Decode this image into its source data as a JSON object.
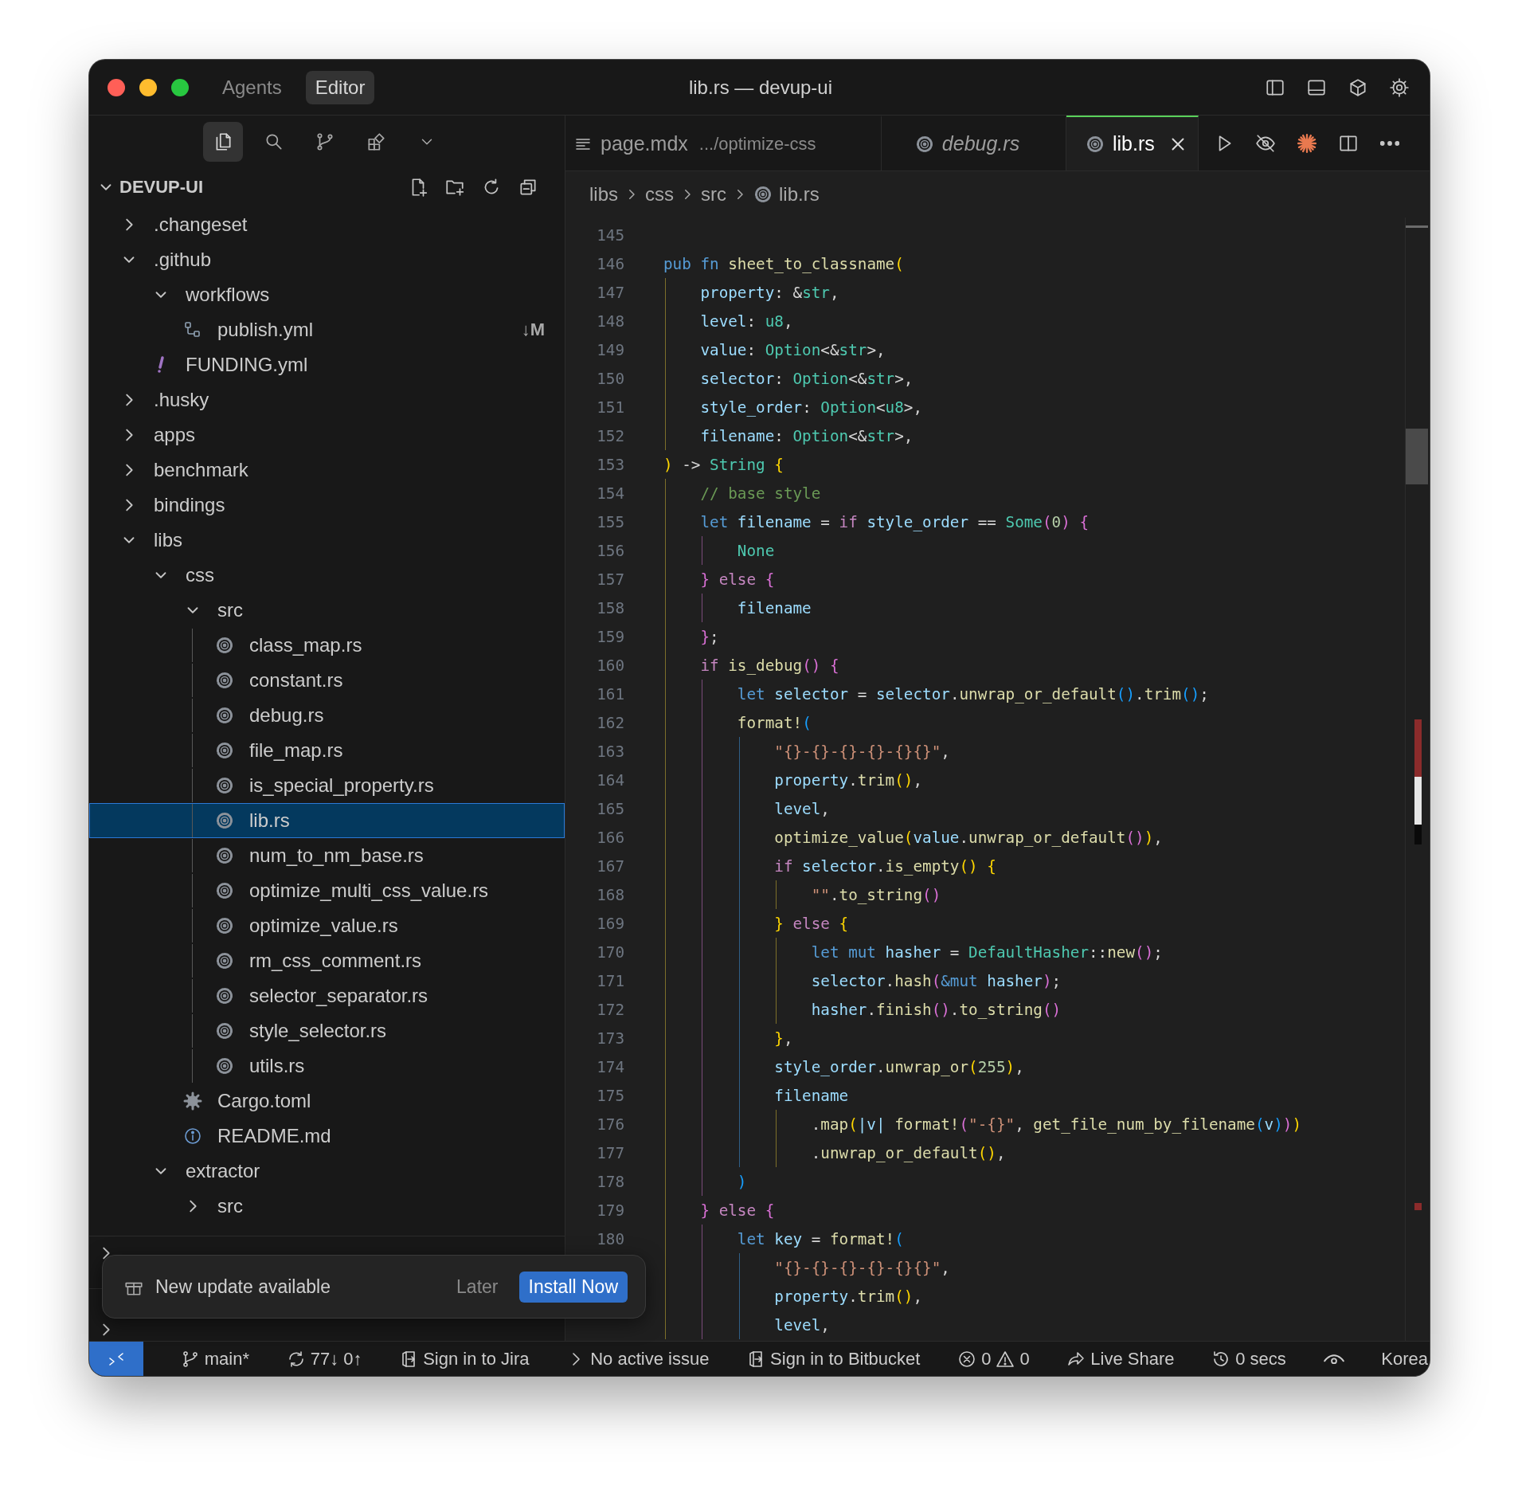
{
  "window": {
    "title": "lib.rs — devup-ui"
  },
  "mode_tabs": [
    {
      "label": "Agents",
      "selected": false
    },
    {
      "label": "Editor",
      "selected": true
    }
  ],
  "activity_bar": [
    {
      "selected": true
    },
    {
      "selected": false
    },
    {
      "selected": false
    },
    {
      "selected": false
    }
  ],
  "explorer": {
    "title": "DEVUP-UI",
    "expanded": true,
    "tree": [
      {
        "label": ".changeset",
        "kind": "folder",
        "expanded": false,
        "selected": false
      },
      {
        "label": ".github",
        "kind": "folder",
        "expanded": true,
        "selected": false,
        "children": [
          {
            "label": "workflows",
            "kind": "folder",
            "expanded": true,
            "selected": false,
            "children": [
              {
                "label": "publish.yml",
                "kind": "workflow",
                "selected": false,
                "badge": "↓M"
              }
            ]
          },
          {
            "label": "FUNDING.yml",
            "kind": "yaml",
            "selected": false
          }
        ]
      },
      {
        "label": ".husky",
        "kind": "folder",
        "expanded": false,
        "selected": false
      },
      {
        "label": "apps",
        "kind": "folder",
        "expanded": false,
        "selected": false
      },
      {
        "label": "benchmark",
        "kind": "folder",
        "expanded": false,
        "selected": false
      },
      {
        "label": "bindings",
        "kind": "folder",
        "expanded": false,
        "selected": false
      },
      {
        "label": "libs",
        "kind": "folder",
        "expanded": true,
        "selected": false,
        "children": [
          {
            "label": "css",
            "kind": "folder",
            "expanded": true,
            "selected": false,
            "children": [
              {
                "label": "src",
                "kind": "folder",
                "expanded": true,
                "selected": false,
                "children": [
                  {
                    "label": "class_map.rs",
                    "kind": "rust",
                    "selected": false
                  },
                  {
                    "label": "constant.rs",
                    "kind": "rust",
                    "selected": false
                  },
                  {
                    "label": "debug.rs",
                    "kind": "rust",
                    "selected": false
                  },
                  {
                    "label": "file_map.rs",
                    "kind": "rust",
                    "selected": false
                  },
                  {
                    "label": "is_special_property.rs",
                    "kind": "rust",
                    "selected": false
                  },
                  {
                    "label": "lib.rs",
                    "kind": "rust",
                    "selected": true
                  },
                  {
                    "label": "num_to_nm_base.rs",
                    "kind": "rust",
                    "selected": false
                  },
                  {
                    "label": "optimize_multi_css_value.rs",
                    "kind": "rust",
                    "selected": false
                  },
                  {
                    "label": "optimize_value.rs",
                    "kind": "rust",
                    "selected": false
                  },
                  {
                    "label": "rm_css_comment.rs",
                    "kind": "rust",
                    "selected": false
                  },
                  {
                    "label": "selector_separator.rs",
                    "kind": "rust",
                    "selected": false
                  },
                  {
                    "label": "style_selector.rs",
                    "kind": "rust",
                    "selected": false
                  },
                  {
                    "label": "utils.rs",
                    "kind": "rust",
                    "selected": false
                  }
                ]
              },
              {
                "label": "Cargo.toml",
                "kind": "config",
                "selected": false
              },
              {
                "label": "README.md",
                "kind": "info",
                "selected": false
              }
            ]
          },
          {
            "label": "extractor",
            "kind": "folder",
            "expanded": true,
            "selected": false,
            "children": [
              {
                "label": "src",
                "kind": "folder",
                "expanded": false,
                "selected": false
              }
            ]
          }
        ]
      }
    ]
  },
  "sections": [
    {
      "expanded": false
    },
    {
      "expanded": false
    }
  ],
  "tabs": [
    {
      "label": "page.mdx",
      "description": ".../optimize-css",
      "kind": "markdown",
      "selected": false,
      "preview": false
    },
    {
      "label": "debug.rs",
      "kind": "rust",
      "selected": false,
      "preview": true
    },
    {
      "label": "lib.rs",
      "kind": "rust",
      "selected": true,
      "preview": false
    }
  ],
  "breadcrumb": [
    {
      "label": "libs",
      "kind": "folder"
    },
    {
      "label": "css",
      "kind": "folder"
    },
    {
      "label": "src",
      "kind": "folder"
    },
    {
      "label": "lib.rs",
      "kind": "rust"
    }
  ],
  "editor": {
    "lines": [
      {
        "number": "145"
      },
      {
        "number": "146",
        "tokens": [
          {
            "text": "pub",
            "kind": "keyword"
          },
          {
            "text": " fn",
            "kind": "keyword"
          },
          {
            "text": " sheet_to_classname",
            "kind": "function"
          },
          {
            "text": "(",
            "kind": "bracket1"
          }
        ]
      },
      {
        "number": "147",
        "tokens": [
          {
            "text": "    property",
            "kind": "variable"
          },
          {
            "text": ": &",
            "kind": "plain"
          },
          {
            "text": "str",
            "kind": "type"
          },
          {
            "text": ",",
            "kind": "plain"
          }
        ]
      },
      {
        "number": "148",
        "tokens": [
          {
            "text": "    level",
            "kind": "variable"
          },
          {
            "text": ": ",
            "kind": "plain"
          },
          {
            "text": "u8",
            "kind": "type"
          },
          {
            "text": ",",
            "kind": "plain"
          }
        ]
      },
      {
        "number": "149",
        "tokens": [
          {
            "text": "    value",
            "kind": "variable"
          },
          {
            "text": ": ",
            "kind": "plain"
          },
          {
            "text": "Option",
            "kind": "type"
          },
          {
            "text": "<&",
            "kind": "plain"
          },
          {
            "text": "str",
            "kind": "type"
          },
          {
            "text": ">,",
            "kind": "plain"
          }
        ]
      },
      {
        "number": "150",
        "tokens": [
          {
            "text": "    selector",
            "kind": "variable"
          },
          {
            "text": ": ",
            "kind": "plain"
          },
          {
            "text": "Option",
            "kind": "type"
          },
          {
            "text": "<&",
            "kind": "plain"
          },
          {
            "text": "str",
            "kind": "type"
          },
          {
            "text": ">,",
            "kind": "plain"
          }
        ]
      },
      {
        "number": "151",
        "tokens": [
          {
            "text": "    style_order",
            "kind": "variable"
          },
          {
            "text": ": ",
            "kind": "plain"
          },
          {
            "text": "Option",
            "kind": "type"
          },
          {
            "text": "<",
            "kind": "plain"
          },
          {
            "text": "u8",
            "kind": "type"
          },
          {
            "text": ">,",
            "kind": "plain"
          }
        ]
      },
      {
        "number": "152",
        "tokens": [
          {
            "text": "    filename",
            "kind": "variable"
          },
          {
            "text": ": ",
            "kind": "plain"
          },
          {
            "text": "Option",
            "kind": "type"
          },
          {
            "text": "<&",
            "kind": "plain"
          },
          {
            "text": "str",
            "kind": "type"
          },
          {
            "text": ">,",
            "kind": "plain"
          }
        ]
      },
      {
        "number": "153",
        "tokens": [
          {
            "text": ")",
            "kind": "bracket1"
          },
          {
            "text": " -> ",
            "kind": "plain"
          },
          {
            "text": "String",
            "kind": "type"
          },
          {
            "text": " {",
            "kind": "bracket1"
          }
        ]
      },
      {
        "number": "154",
        "tokens": [
          {
            "text": "    // base style",
            "kind": "comment"
          }
        ]
      },
      {
        "number": "155",
        "tokens": [
          {
            "text": "    let",
            "kind": "keyword"
          },
          {
            "text": " filename",
            "kind": "variable"
          },
          {
            "text": " = ",
            "kind": "plain"
          },
          {
            "text": "if",
            "kind": "control"
          },
          {
            "text": " style_order",
            "kind": "variable"
          },
          {
            "text": " == ",
            "kind": "plain"
          },
          {
            "text": "Some",
            "kind": "type"
          },
          {
            "text": "(",
            "kind": "bracket2"
          },
          {
            "text": "0",
            "kind": "number"
          },
          {
            "text": ")",
            "kind": "bracket2"
          },
          {
            "text": " {",
            "kind": "bracket2"
          }
        ]
      },
      {
        "number": "156",
        "tokens": [
          {
            "text": "        None",
            "kind": "type"
          }
        ]
      },
      {
        "number": "157",
        "tokens": [
          {
            "text": "    }",
            "kind": "bracket2"
          },
          {
            "text": " else",
            "kind": "control"
          },
          {
            "text": " {",
            "kind": "bracket2"
          }
        ]
      },
      {
        "number": "158",
        "tokens": [
          {
            "text": "        filename",
            "kind": "variable"
          }
        ]
      },
      {
        "number": "159",
        "tokens": [
          {
            "text": "    }",
            "kind": "bracket2"
          },
          {
            "text": ";",
            "kind": "plain"
          }
        ]
      },
      {
        "number": "160",
        "tokens": [
          {
            "text": "    if",
            "kind": "control"
          },
          {
            "text": " is_debug",
            "kind": "function"
          },
          {
            "text": "()",
            "kind": "bracket2"
          },
          {
            "text": " {",
            "kind": "bracket2"
          }
        ]
      },
      {
        "number": "161",
        "tokens": [
          {
            "text": "        let",
            "kind": "keyword"
          },
          {
            "text": " selector",
            "kind": "variable"
          },
          {
            "text": " = ",
            "kind": "plain"
          },
          {
            "text": "selector",
            "kind": "variable"
          },
          {
            "text": ".unwrap_or_default",
            "kind": "function"
          },
          {
            "text": "()",
            "kind": "bracket3"
          },
          {
            "text": ".trim",
            "kind": "function"
          },
          {
            "text": "()",
            "kind": "bracket3"
          },
          {
            "text": ";",
            "kind": "plain"
          }
        ]
      },
      {
        "number": "162",
        "tokens": [
          {
            "text": "        format!",
            "kind": "function"
          },
          {
            "text": "(",
            "kind": "bracket3"
          }
        ]
      },
      {
        "number": "163",
        "tokens": [
          {
            "text": "            \"{}-{}-{}-{}-{}{}\"",
            "kind": "string"
          },
          {
            "text": ",",
            "kind": "plain"
          }
        ]
      },
      {
        "number": "164",
        "tokens": [
          {
            "text": "            property",
            "kind": "variable"
          },
          {
            "text": ".trim",
            "kind": "function"
          },
          {
            "text": "()",
            "kind": "bracket1"
          },
          {
            "text": ",",
            "kind": "plain"
          }
        ]
      },
      {
        "number": "165",
        "tokens": [
          {
            "text": "            level",
            "kind": "variable"
          },
          {
            "text": ",",
            "kind": "plain"
          }
        ]
      },
      {
        "number": "166",
        "tokens": [
          {
            "text": "            optimize_value",
            "kind": "function"
          },
          {
            "text": "(",
            "kind": "bracket1"
          },
          {
            "text": "value",
            "kind": "variable"
          },
          {
            "text": ".unwrap_or_default",
            "kind": "function"
          },
          {
            "text": "()",
            "kind": "bracket2"
          },
          {
            "text": ")",
            "kind": "bracket1"
          },
          {
            "text": ",",
            "kind": "plain"
          }
        ]
      },
      {
        "number": "167",
        "tokens": [
          {
            "text": "            if",
            "kind": "control"
          },
          {
            "text": " selector",
            "kind": "variable"
          },
          {
            "text": ".is_empty",
            "kind": "function"
          },
          {
            "text": "()",
            "kind": "bracket1"
          },
          {
            "text": " {",
            "kind": "bracket1"
          }
        ]
      },
      {
        "number": "168",
        "tokens": [
          {
            "text": "                \"\"",
            "kind": "string"
          },
          {
            "text": ".to_string",
            "kind": "function"
          },
          {
            "text": "()",
            "kind": "bracket2"
          }
        ]
      },
      {
        "number": "169",
        "tokens": [
          {
            "text": "            }",
            "kind": "bracket1"
          },
          {
            "text": " else",
            "kind": "control"
          },
          {
            "text": " {",
            "kind": "bracket1"
          }
        ]
      },
      {
        "number": "170",
        "tokens": [
          {
            "text": "                let",
            "kind": "keyword"
          },
          {
            "text": " mut",
            "kind": "keyword"
          },
          {
            "text": " hasher",
            "kind": "variable"
          },
          {
            "text": " = ",
            "kind": "plain"
          },
          {
            "text": "DefaultHasher",
            "kind": "type"
          },
          {
            "text": "::",
            "kind": "plain"
          },
          {
            "text": "new",
            "kind": "function"
          },
          {
            "text": "()",
            "kind": "bracket2"
          },
          {
            "text": ";",
            "kind": "plain"
          }
        ]
      },
      {
        "number": "171",
        "tokens": [
          {
            "text": "                selector",
            "kind": "variable"
          },
          {
            "text": ".hash",
            "kind": "function"
          },
          {
            "text": "(",
            "kind": "bracket2"
          },
          {
            "text": "&mut",
            "kind": "keyword"
          },
          {
            "text": " hasher",
            "kind": "variable"
          },
          {
            "text": ")",
            "kind": "bracket2"
          },
          {
            "text": ";",
            "kind": "plain"
          }
        ]
      },
      {
        "number": "172",
        "tokens": [
          {
            "text": "                hasher",
            "kind": "variable"
          },
          {
            "text": ".finish",
            "kind": "function"
          },
          {
            "text": "()",
            "kind": "bracket2"
          },
          {
            "text": ".to_string",
            "kind": "function"
          },
          {
            "text": "()",
            "kind": "bracket2"
          }
        ]
      },
      {
        "number": "173",
        "tokens": [
          {
            "text": "            }",
            "kind": "bracket1"
          },
          {
            "text": ",",
            "kind": "plain"
          }
        ]
      },
      {
        "number": "174",
        "tokens": [
          {
            "text": "            style_order",
            "kind": "variable"
          },
          {
            "text": ".unwrap_or",
            "kind": "function"
          },
          {
            "text": "(",
            "kind": "bracket1"
          },
          {
            "text": "255",
            "kind": "number"
          },
          {
            "text": ")",
            "kind": "bracket1"
          },
          {
            "text": ",",
            "kind": "plain"
          }
        ]
      },
      {
        "number": "175",
        "tokens": [
          {
            "text": "            filename",
            "kind": "variable"
          }
        ]
      },
      {
        "number": "176",
        "tokens": [
          {
            "text": "                .map",
            "kind": "function"
          },
          {
            "text": "(",
            "kind": "bracket1"
          },
          {
            "text": "|v|",
            "kind": "variable"
          },
          {
            "text": " format!",
            "kind": "function"
          },
          {
            "text": "(",
            "kind": "bracket2"
          },
          {
            "text": "\"-{}\"",
            "kind": "string"
          },
          {
            "text": ", ",
            "kind": "plain"
          },
          {
            "text": "get_file_num_by_filename",
            "kind": "function"
          },
          {
            "text": "(",
            "kind": "bracket3"
          },
          {
            "text": "v",
            "kind": "variable"
          },
          {
            "text": ")",
            "kind": "bracket3"
          },
          {
            "text": ")",
            "kind": "bracket2"
          },
          {
            "text": ")",
            "kind": "bracket1"
          }
        ]
      },
      {
        "number": "177",
        "tokens": [
          {
            "text": "                .unwrap_or_default",
            "kind": "function"
          },
          {
            "text": "()",
            "kind": "bracket1"
          },
          {
            "text": ",",
            "kind": "plain"
          }
        ]
      },
      {
        "number": "178",
        "tokens": [
          {
            "text": "        )",
            "kind": "bracket3"
          }
        ]
      },
      {
        "number": "179",
        "tokens": [
          {
            "text": "    }",
            "kind": "bracket2"
          },
          {
            "text": " else",
            "kind": "control"
          },
          {
            "text": " {",
            "kind": "bracket2"
          }
        ]
      },
      {
        "number": "180",
        "tokens": [
          {
            "text": "        let",
            "kind": "keyword"
          },
          {
            "text": " key",
            "kind": "variable"
          },
          {
            "text": " = ",
            "kind": "plain"
          },
          {
            "text": "format!",
            "kind": "function"
          },
          {
            "text": "(",
            "kind": "bracket3"
          }
        ]
      },
      {
        "tokens": [
          {
            "text": "            \"{}-{}-{}-{}-{}{}\"",
            "kind": "string"
          },
          {
            "text": ",",
            "kind": "plain"
          }
        ]
      },
      {
        "tokens": [
          {
            "text": "            property",
            "kind": "variable"
          },
          {
            "text": ".trim",
            "kind": "function"
          },
          {
            "text": "()",
            "kind": "bracket1"
          },
          {
            "text": ",",
            "kind": "plain"
          }
        ]
      },
      {
        "tokens": [
          {
            "text": "            level",
            "kind": "variable"
          },
          {
            "text": ",",
            "kind": "plain"
          }
        ]
      }
    ]
  },
  "notification": {
    "message": "New update available",
    "actions": [
      {
        "label": "Later",
        "primary": false
      },
      {
        "label": "Install Now",
        "primary": true
      }
    ]
  },
  "status_bar": {
    "items": [
      {
        "kind": "remote"
      },
      {
        "kind": "branch",
        "text": "main*"
      },
      {
        "kind": "sync",
        "text": "77↓ 0↑"
      },
      {
        "kind": "jira",
        "text": "Sign in to Jira"
      },
      {
        "kind": "issue",
        "text": "No active issue"
      },
      {
        "kind": "bitbucket",
        "text": "Sign in to Bitbucket"
      },
      {
        "kind": "problems",
        "errors": "0",
        "warnings": "0"
      },
      {
        "kind": "liveshare",
        "text": "Live Share"
      },
      {
        "kind": "time",
        "text": "0 secs"
      },
      {
        "kind": "eye"
      },
      {
        "kind": "language",
        "text": "Korea"
      }
    ]
  }
}
